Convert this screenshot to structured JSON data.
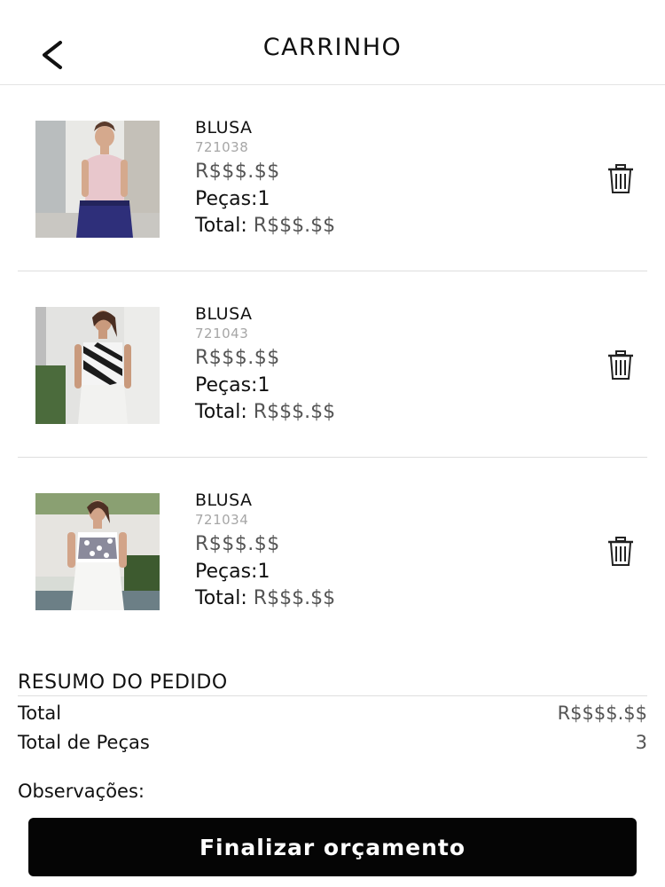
{
  "header": {
    "title": "CARRINHO",
    "back_icon": "chevron-left-icon"
  },
  "items": [
    {
      "name": "BLUSA",
      "code": "721038",
      "price": "R$$$.$$",
      "qty_label": "Peças:1",
      "total_label": "Total:",
      "total_value": "R$$$.$$",
      "delete_icon": "trash-icon"
    },
    {
      "name": "BLUSA",
      "code": "721043",
      "price": "R$$$.$$",
      "qty_label": "Peças:1",
      "total_label": "Total:",
      "total_value": "R$$$.$$",
      "delete_icon": "trash-icon"
    },
    {
      "name": "BLUSA",
      "code": "721034",
      "price": "R$$$.$$",
      "qty_label": "Peças:1",
      "total_label": "Total:",
      "total_value": "R$$$.$$",
      "delete_icon": "trash-icon"
    }
  ],
  "summary": {
    "title": "RESUMO DO PEDIDO",
    "total_label": "Total",
    "total_value": "R$$$$.$$",
    "pieces_label": "Total de Peças",
    "pieces_value": "3",
    "notes_label": "Observações:"
  },
  "actions": {
    "finish_label": "Finalizar orçamento"
  },
  "colors": {
    "primary_button": "#050505",
    "muted_text": "#a6a6a6",
    "price_text": "#555555",
    "divider": "#dedede"
  }
}
